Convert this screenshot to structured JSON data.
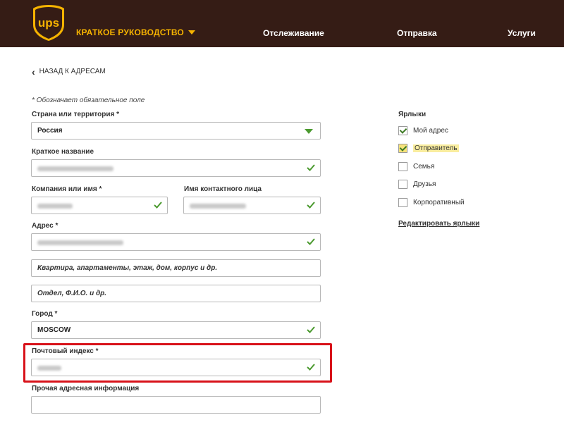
{
  "header": {
    "logo_text": "ups",
    "quick_guide": "КРАТКОЕ РУКОВОДСТВО",
    "nav": [
      "Отслеживание",
      "Отправка",
      "Услуги"
    ]
  },
  "back_link": "НАЗАД К АДРЕСАМ",
  "required_note": "* Обозначает обязательное поле",
  "form": {
    "country_label": "Страна или территория *",
    "country_value": "Россия",
    "short_name_label": "Краткое название",
    "company_label": "Компания или имя *",
    "contact_label": "Имя контактного лица",
    "address_label": "Адрес *",
    "address2_placeholder": "Квартира, апартаменты, этаж, дом, корпус и др.",
    "address3_placeholder": "Отдел, Ф.И.О. и др.",
    "city_label": "Город *",
    "city_value": "MOSCOW",
    "postal_label": "Почтовый индекс *",
    "other_label": "Прочая адресная информация"
  },
  "labels_panel": {
    "title": "Ярлыки",
    "items": [
      {
        "label": "Мой адрес",
        "checked": true
      },
      {
        "label": "Отправитель",
        "checked": true
      },
      {
        "label": "Семья",
        "checked": false
      },
      {
        "label": "Друзья",
        "checked": false
      },
      {
        "label": "Корпоративный",
        "checked": false
      }
    ],
    "edit_link": "Редактировать ярлыки"
  },
  "colors": {
    "header_bg": "#351c15",
    "accent_gold": "#f6b300",
    "valid_green": "#4b9a2f",
    "highlight_red": "#d8121a"
  }
}
